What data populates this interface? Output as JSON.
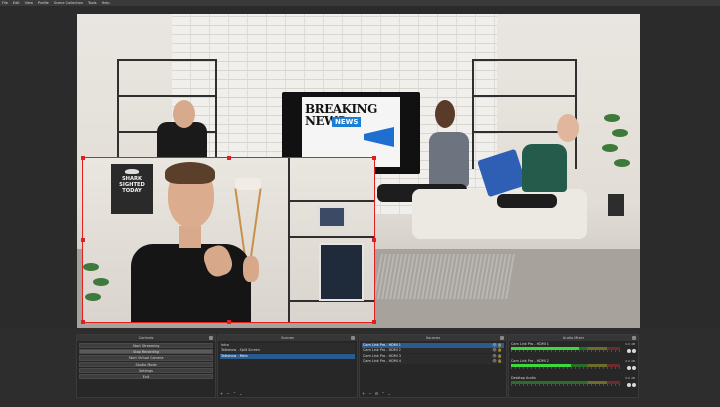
{
  "menu": [
    "File",
    "Edit",
    "View",
    "Profile",
    "Scene Collection",
    "Tools",
    "Help"
  ],
  "preview": {
    "tv_headline": "BREAKING NEWS",
    "tv_badge": "NEWS",
    "sign_text": "SHARK SIGHTED TODAY"
  },
  "controls": {
    "title": "Controls",
    "buttons": [
      "Start Streaming",
      "Stop Recording",
      "Start Virtual Camera",
      "Studio Mode",
      "Settings",
      "Exit"
    ],
    "active_index": 1
  },
  "scenes": {
    "title": "Scenes",
    "items": [
      "Intro",
      "Talkshow - Split Screen",
      "Talkshow - Main"
    ],
    "selected_index": 2,
    "footer": [
      "+",
      "−",
      "⌃",
      "⌄"
    ]
  },
  "sources": {
    "title": "Sources",
    "items": [
      "Cam Link Pro - HDMI 1",
      "Cam Link Pro - HDMI 2",
      "Cam Link Pro - HDMI 3",
      "Cam Link Pro - HDMI 4"
    ],
    "selected_index": 0,
    "footer": [
      "+",
      "−",
      "⚙",
      "⌃",
      "⌄"
    ]
  },
  "mixer": {
    "title": "Audio Mixer",
    "channels": [
      {
        "name": "Cam Link Pro - HDMI 1",
        "db": "0.0 dB",
        "level": 0.62
      },
      {
        "name": "Cam Link Pro - HDMI 2",
        "db": "0.0 dB",
        "level": 0.55
      },
      {
        "name": "Desktop Audio",
        "db": "0.0 dB",
        "level": 0.0
      }
    ]
  },
  "colors": {
    "selection_outline": "#e01f1f",
    "selected_row": "#2b5b8e",
    "meter_green": "#3fd63f"
  }
}
